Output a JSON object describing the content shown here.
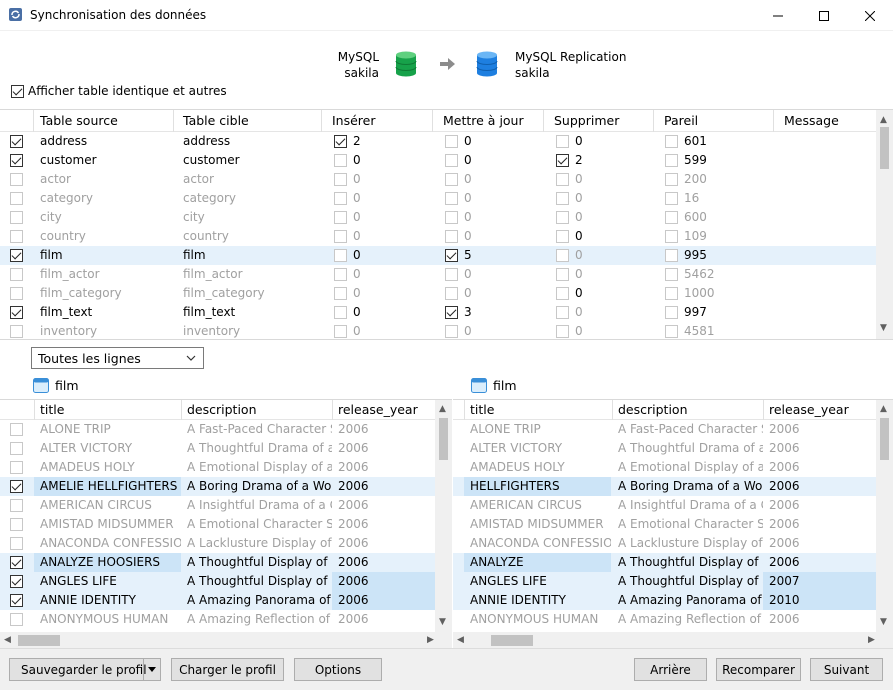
{
  "window": {
    "title": "Synchronisation des données"
  },
  "source_db": {
    "type": "MySQL",
    "name": "sakila"
  },
  "target_db": {
    "type": "MySQL Replication",
    "name": "sakila"
  },
  "show_identical": {
    "label": "Afficher table identique et autres",
    "checked": true
  },
  "tables": {
    "columns": [
      "Table source",
      "Table cible",
      "Insérer",
      "Mettre à jour",
      "Supprimer",
      "Pareil",
      "Message"
    ],
    "rows": [
      {
        "checked": true,
        "active": true,
        "selected": false,
        "source": "address",
        "target": "address",
        "insert": "2",
        "insert_on": true,
        "update": "0",
        "update_on": false,
        "delete": "0",
        "delete_on": false,
        "same": "601"
      },
      {
        "checked": true,
        "active": true,
        "selected": false,
        "source": "customer",
        "target": "customer",
        "insert": "0",
        "insert_on": false,
        "update": "0",
        "update_on": false,
        "delete": "2",
        "delete_on": true,
        "same": "599"
      },
      {
        "checked": false,
        "active": false,
        "selected": false,
        "source": "actor",
        "target": "actor",
        "insert": "0",
        "insert_on": false,
        "update": "0",
        "update_on": false,
        "delete": "0",
        "delete_on": false,
        "same": "200"
      },
      {
        "checked": false,
        "active": false,
        "selected": false,
        "source": "category",
        "target": "category",
        "insert": "0",
        "insert_on": false,
        "update": "0",
        "update_on": false,
        "delete": "0",
        "delete_on": false,
        "same": "16"
      },
      {
        "checked": false,
        "active": false,
        "selected": false,
        "source": "city",
        "target": "city",
        "insert": "0",
        "insert_on": false,
        "update": "0",
        "update_on": false,
        "delete": "0",
        "delete_on": false,
        "same": "600"
      },
      {
        "checked": false,
        "active": false,
        "selected": false,
        "source": "country",
        "target": "country",
        "insert": "0",
        "insert_on": false,
        "update": "0",
        "update_on": false,
        "delete": "0",
        "delete_on": false,
        "same": "109",
        "delete_dark": true
      },
      {
        "checked": true,
        "active": true,
        "selected": true,
        "source": "film",
        "target": "film",
        "insert": "0",
        "insert_on": false,
        "update": "5",
        "update_on": true,
        "delete": "0",
        "delete_on": false,
        "same": "995",
        "delete_gray": true
      },
      {
        "checked": false,
        "active": false,
        "selected": false,
        "source": "film_actor",
        "target": "film_actor",
        "insert": "0",
        "insert_on": false,
        "update": "0",
        "update_on": false,
        "delete": "0",
        "delete_on": false,
        "same": "5462"
      },
      {
        "checked": false,
        "active": false,
        "selected": false,
        "source": "film_category",
        "target": "film_category",
        "insert": "0",
        "insert_on": false,
        "update": "0",
        "update_on": false,
        "delete": "0",
        "delete_on": false,
        "same": "1000",
        "delete_dark": true
      },
      {
        "checked": true,
        "active": true,
        "selected": false,
        "source": "film_text",
        "target": "film_text",
        "insert": "0",
        "insert_on": false,
        "update": "3",
        "update_on": true,
        "delete": "0",
        "delete_on": false,
        "same": "997",
        "delete_gray": true
      },
      {
        "checked": false,
        "active": false,
        "selected": false,
        "source": "inventory",
        "target": "inventory",
        "insert": "0",
        "insert_on": false,
        "update": "0",
        "update_on": false,
        "delete": "0",
        "delete_on": false,
        "same": "4581"
      }
    ]
  },
  "filter": {
    "selected": "Toutes les lignes"
  },
  "left_table": {
    "name": "film",
    "columns": [
      "title",
      "description",
      "release_year"
    ],
    "rows": [
      {
        "checked": false,
        "active": false,
        "title": "ALONE TRIP",
        "description": "A Fast-Paced Character Stud",
        "year": "2006"
      },
      {
        "checked": false,
        "active": false,
        "title": "ALTER VICTORY",
        "description": "A Thoughtful Drama of a Cc",
        "year": "2006"
      },
      {
        "checked": false,
        "active": false,
        "title": "AMADEUS HOLY",
        "description": "A Emotional Display of a Pic",
        "year": "2006"
      },
      {
        "checked": true,
        "active": true,
        "title": "AMELIE HELLFIGHTERS",
        "description": "A Boring Drama of a Woma",
        "year": "2006",
        "title_hl": true
      },
      {
        "checked": false,
        "active": false,
        "title": "AMERICAN CIRCUS",
        "description": "A Insightful Drama of a Girl",
        "year": "2006"
      },
      {
        "checked": false,
        "active": false,
        "title": "AMISTAD MIDSUMMER",
        "description": "A Emotional Character Stud",
        "year": "2006"
      },
      {
        "checked": false,
        "active": false,
        "title": "ANACONDA CONFESSIO",
        "description": "A Lacklusture Display of a D",
        "year": "2006"
      },
      {
        "checked": true,
        "active": true,
        "title": "ANALYZE HOOSIERS",
        "description": "A Thoughtful Display of a E",
        "year": "2006",
        "title_hl": true
      },
      {
        "checked": true,
        "active": true,
        "title": "ANGLES LIFE",
        "description": "A Thoughtful Display of a W",
        "year": "2006",
        "year_hl": true
      },
      {
        "checked": true,
        "active": true,
        "title": "ANNIE IDENTITY",
        "description": "A Amazing Panorama of a P",
        "year": "2006",
        "year_hl": true
      },
      {
        "checked": false,
        "active": false,
        "title": "ANONYMOUS HUMAN",
        "description": "A Amazing Reflection of a",
        "year": "2006"
      }
    ]
  },
  "right_table": {
    "name": "film",
    "columns": [
      "title",
      "description",
      "release_year"
    ],
    "rows": [
      {
        "active": false,
        "title": "ALONE TRIP",
        "description": "A Fast-Paced Character Stuc",
        "year": "2006"
      },
      {
        "active": false,
        "title": "ALTER VICTORY",
        "description": "A Thoughtful Drama of a Cc",
        "year": "2006"
      },
      {
        "active": false,
        "title": "AMADEUS HOLY",
        "description": "A Emotional Display of a Pic",
        "year": "2006"
      },
      {
        "active": true,
        "title": "HELLFIGHTERS",
        "description": "A Boring Drama of a Woma",
        "year": "2006",
        "title_hl": true
      },
      {
        "active": false,
        "title": "AMERICAN CIRCUS",
        "description": "A Insightful Drama of a Girl",
        "year": "2006"
      },
      {
        "active": false,
        "title": "AMISTAD MIDSUMMER",
        "description": "A Emotional Character Stud",
        "year": "2006"
      },
      {
        "active": false,
        "title": "ANACONDA CONFESSIO",
        "description": "A Lacklusture Display of a D",
        "year": "2006"
      },
      {
        "active": true,
        "title": "ANALYZE",
        "description": "A Thoughtful Display of a E",
        "year": "2006",
        "title_hl": true
      },
      {
        "active": true,
        "title": "ANGLES LIFE",
        "description": "A Thoughtful Display of a W",
        "year": "2007",
        "year_hl": true
      },
      {
        "active": true,
        "title": "ANNIE IDENTITY",
        "description": "A Amazing Panorama of a P",
        "year": "2010",
        "year_hl": true
      },
      {
        "active": false,
        "title": "ANONYMOUS HUMAN",
        "description": "A Amazing Reflection of a",
        "year": "2006"
      }
    ]
  },
  "buttons": {
    "save_profile": "Sauvegarder le profil",
    "load_profile": "Charger le profil",
    "options": "Options",
    "back": "Arrière",
    "compare": "Recomparer",
    "next": "Suivant"
  },
  "colors": {
    "selected_row": "#e5f1fb",
    "changed_cell": "#cce4f7",
    "source_db": "#1aa34a",
    "target_db": "#1e88e5"
  }
}
